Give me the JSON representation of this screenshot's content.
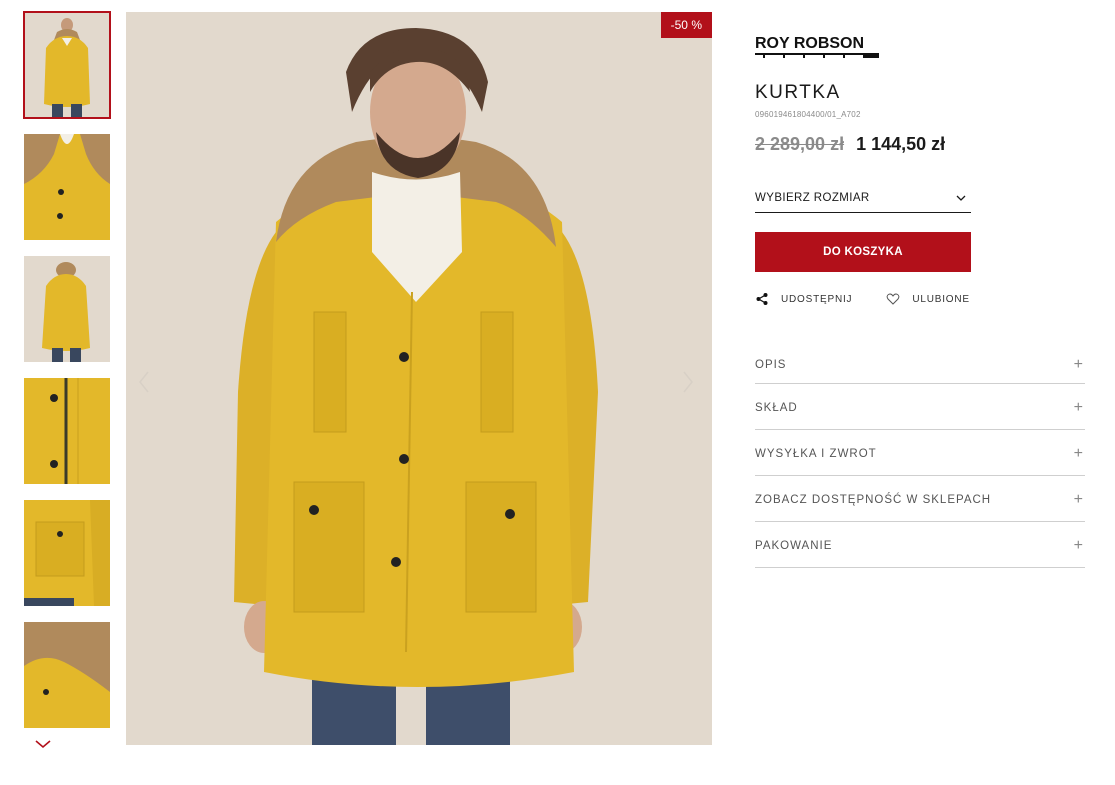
{
  "gallery": {
    "thumbnails": [
      "front",
      "hood-detail",
      "back",
      "zip-detail",
      "pocket-detail",
      "fur-detail"
    ],
    "badge": "-50 %"
  },
  "brand": {
    "name": "ROY ROBSON"
  },
  "product": {
    "title": "KURTKA",
    "sku": "096019461804400/01_A702",
    "price_old": "2 289,00 zł",
    "price_new": "1 144,50 zł"
  },
  "size_select": {
    "label": "WYBIERZ ROZMIAR"
  },
  "cart_button": {
    "label": "DO KOSZYKA"
  },
  "actions": {
    "share": "UDOSTĘPNIJ",
    "favorite": "ULUBIONE"
  },
  "accordion": [
    {
      "label": "OPIS"
    },
    {
      "label": "SKŁAD"
    },
    {
      "label": "WYSYŁKA I ZWROT"
    },
    {
      "label": "ZOBACZ DOSTĘPNOŚĆ W SKLEPACH"
    },
    {
      "label": "PAKOWANIE"
    }
  ],
  "colors": {
    "accent": "#b2101a",
    "jacket": "#e3b82a",
    "background": "#e2d9cd"
  }
}
